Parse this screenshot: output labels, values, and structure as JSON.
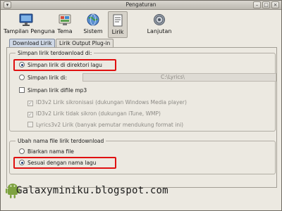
{
  "window": {
    "title": "Pengaturan"
  },
  "titlebar_buttons": {
    "menu": "▾",
    "minimize": "–",
    "maximize": "□",
    "close": "×"
  },
  "toolbar": {
    "items": [
      {
        "label": "Tampilan Penguna",
        "icon": "monitor-icon"
      },
      {
        "label": "Tema",
        "icon": "palette-icon"
      },
      {
        "label": "Sistem",
        "icon": "globe-icon"
      },
      {
        "label": "Lirik",
        "icon": "lyrics-icon",
        "active": true
      },
      {
        "label": "Lanjutan",
        "icon": "gear-icon"
      }
    ]
  },
  "tabs": [
    {
      "label": "Download Lirik",
      "selected": true
    },
    {
      "label": "Lirik Output Plug-in",
      "selected": false
    }
  ],
  "group_download": {
    "title": "Simpan lirik terdownload di:",
    "opt_dir_lagu": "Simpan lirik di direktori lagu",
    "opt_dir": "Simpan lirik di:",
    "dir_value": "C:\\Lyrics\\",
    "opt_mp3": "Simpan lirik difile mp3",
    "sub_id3v2_sync": "ID3v2 Lirik sikronisasi (dukungan Windows Media player)",
    "sub_id3v2_unsync": "ID3v2 Lirik tidak sikron (dukungan iTune, WMP)",
    "sub_lyrics3": "Lyrics3v2 Lirik (banyak pemutar mendukung format ini)"
  },
  "group_rename": {
    "title": "Ubah nama file lirik terdownload",
    "opt_keep": "Biarkan nama file",
    "opt_match": "Sesuai dengan nama lagu"
  },
  "watermark": {
    "text": "Galaxyminiku.blogspot.com"
  },
  "colors": {
    "highlight": "#e01010",
    "tab_selected": "#cfd8e6",
    "window_bg": "#ece9e1"
  }
}
